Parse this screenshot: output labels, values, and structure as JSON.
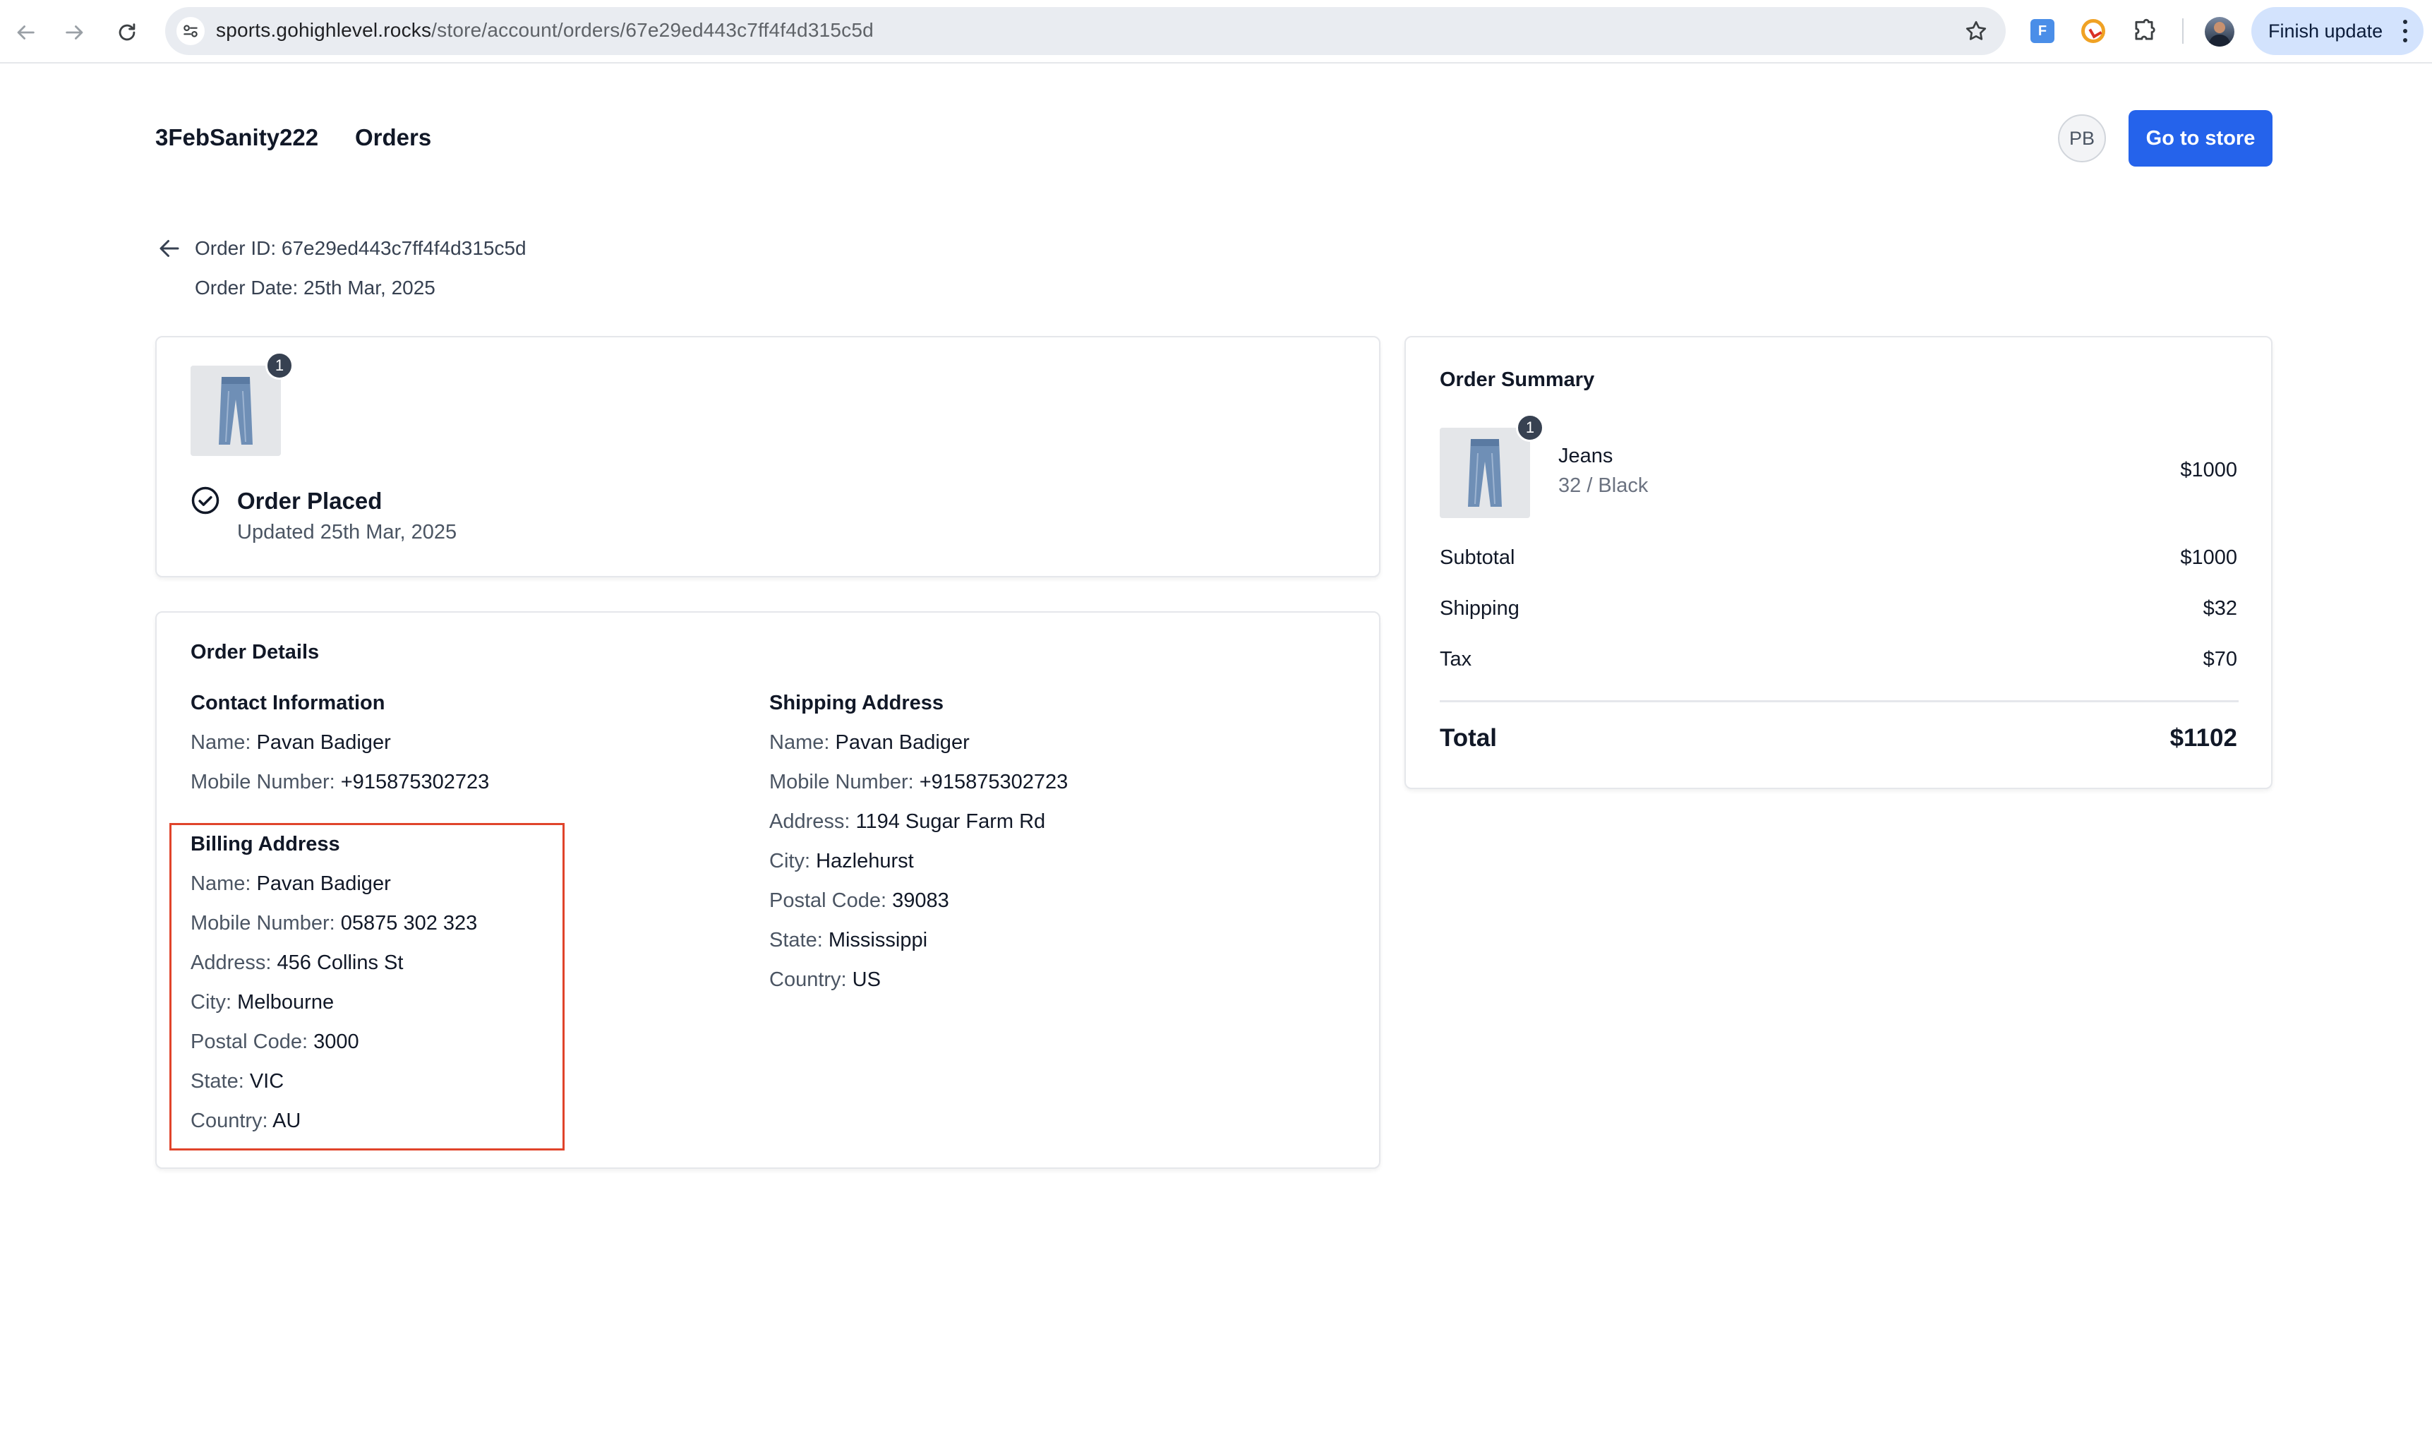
{
  "browser": {
    "url_host": "sports.gohighlevel.rocks",
    "url_path": "/store/account/orders/67e29ed443c7ff4f4d315c5d",
    "finish_update_label": "Finish update"
  },
  "header": {
    "store_name": "3FebSanity222",
    "orders_label": "Orders",
    "avatar_initials": "PB",
    "go_to_store_label": "Go to store"
  },
  "order": {
    "id_text": "Order ID: 67e29ed443c7ff4f4d315c5d",
    "date_text": "Order Date: 25th Mar, 2025"
  },
  "status": {
    "quantity_badge": "1",
    "title": "Order Placed",
    "updated": "Updated 25th Mar, 2025"
  },
  "details": {
    "title": "Order Details",
    "contact": {
      "title": "Contact Information",
      "rows": [
        {
          "label": "Name: ",
          "value": "Pavan Badiger"
        },
        {
          "label": "Mobile Number: ",
          "value": "+915875302723"
        }
      ]
    },
    "billing": {
      "title": "Billing Address",
      "rows": [
        {
          "label": "Name: ",
          "value": "Pavan Badiger"
        },
        {
          "label": "Mobile Number: ",
          "value": "05875 302 323"
        },
        {
          "label": "Address: ",
          "value": "456 Collins St"
        },
        {
          "label": "City: ",
          "value": "Melbourne"
        },
        {
          "label": "Postal Code: ",
          "value": "3000"
        },
        {
          "label": "State: ",
          "value": "VIC"
        },
        {
          "label": "Country: ",
          "value": "AU"
        }
      ]
    },
    "shipping": {
      "title": "Shipping Address",
      "rows": [
        {
          "label": "Name: ",
          "value": "Pavan Badiger"
        },
        {
          "label": "Mobile Number: ",
          "value": "+915875302723"
        },
        {
          "label": "Address: ",
          "value": "1194 Sugar Farm Rd"
        },
        {
          "label": "City: ",
          "value": "Hazlehurst"
        },
        {
          "label": "Postal Code: ",
          "value": "39083"
        },
        {
          "label": "State: ",
          "value": "Mississippi"
        },
        {
          "label": "Country: ",
          "value": "US"
        }
      ]
    }
  },
  "summary": {
    "title": "Order Summary",
    "item": {
      "quantity_badge": "1",
      "name": "Jeans",
      "variant": "32 / Black",
      "price": "$1000"
    },
    "subtotal_label": "Subtotal",
    "subtotal": "$1000",
    "shipping_label": "Shipping",
    "shipping": "$32",
    "tax_label": "Tax",
    "tax": "$70",
    "total_label": "Total",
    "total": "$1102"
  },
  "colors": {
    "primary_button": "#2563eb",
    "highlight_box": "#e0442b"
  },
  "icons": [
    "back-icon",
    "forward-icon",
    "reload-icon",
    "site-settings-icon",
    "bookmark-star-icon",
    "extension-icon",
    "puzzle-icon",
    "kebab-menu-icon",
    "arrow-left-icon",
    "check-circle-icon",
    "jeans-product-image"
  ]
}
